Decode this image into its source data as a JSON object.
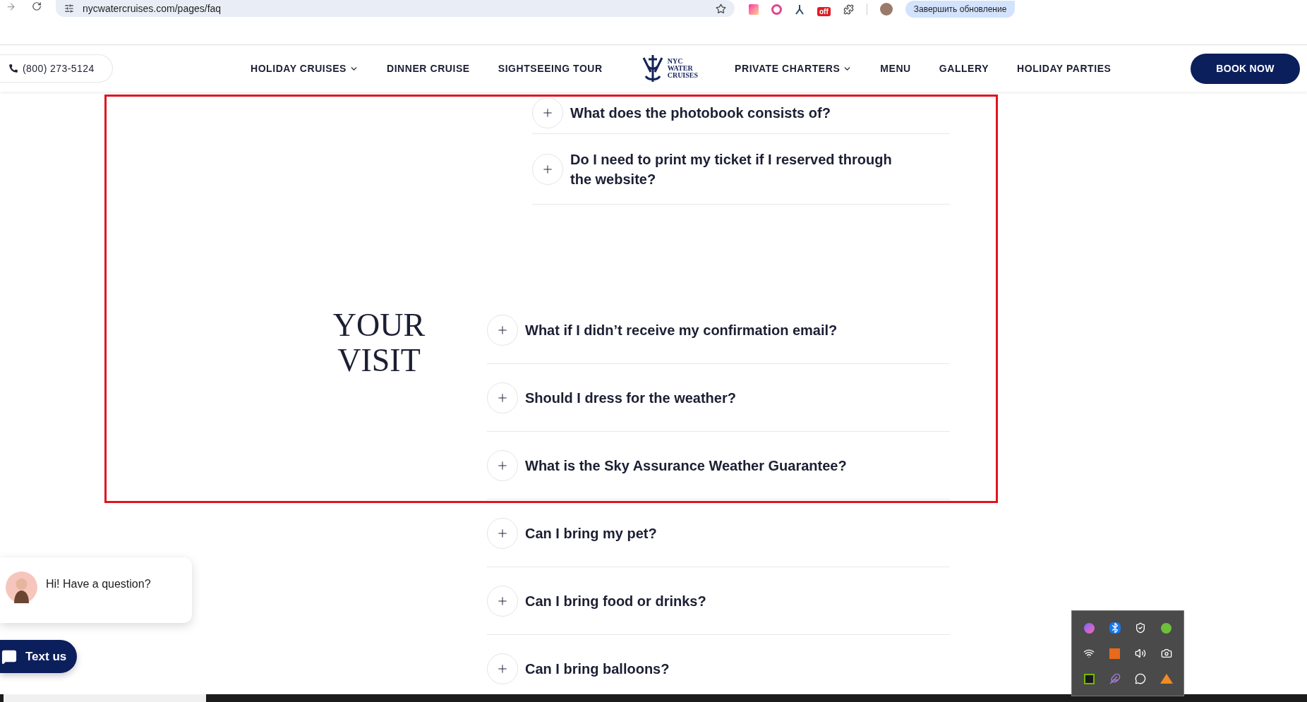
{
  "browser": {
    "url": "nycwatercruises.com/pages/faq",
    "extension_badge": "off",
    "update_button": "Завершить обновление"
  },
  "header": {
    "phone": "(800) 273-5124",
    "nav_left": [
      {
        "label": "HOLIDAY CRUISES",
        "has_menu": true
      },
      {
        "label": "DINNER CRUISE",
        "has_menu": false
      },
      {
        "label": "SIGHTSEEING TOUR",
        "has_menu": false
      }
    ],
    "logo_lines": [
      "NYC",
      "WATER",
      "CRUISES"
    ],
    "nav_right": [
      {
        "label": "PRIVATE CHARTERS",
        "has_menu": true
      },
      {
        "label": "MENU",
        "has_menu": false
      },
      {
        "label": "GALLERY",
        "has_menu": false
      },
      {
        "label": "HOLIDAY PARTIES",
        "has_menu": false
      }
    ],
    "book_button": "BOOK NOW"
  },
  "faq_top": {
    "questions": [
      {
        "text": "What does the photobook consists of?",
        "expanded": false
      },
      {
        "text": "Do I need to print my ticket if I reserved through the website?",
        "expanded": false
      }
    ]
  },
  "faq_visit": {
    "title_lines": [
      "YOUR",
      "VISIT"
    ],
    "questions": [
      {
        "text": "What if I didn’t receive my confirmation email?",
        "expanded": false
      },
      {
        "text": "Should I dress for the weather?",
        "expanded": false
      },
      {
        "text": "What is the Sky Assurance Weather Guarantee?",
        "expanded": false
      },
      {
        "text": "Can I bring my pet?",
        "expanded": false
      },
      {
        "text": "Can I bring food or drinks?",
        "expanded": false
      },
      {
        "text": "Can I bring balloons?",
        "expanded": false
      }
    ]
  },
  "chat": {
    "greeting": "Hi! Have a question?",
    "button": "Text us"
  }
}
